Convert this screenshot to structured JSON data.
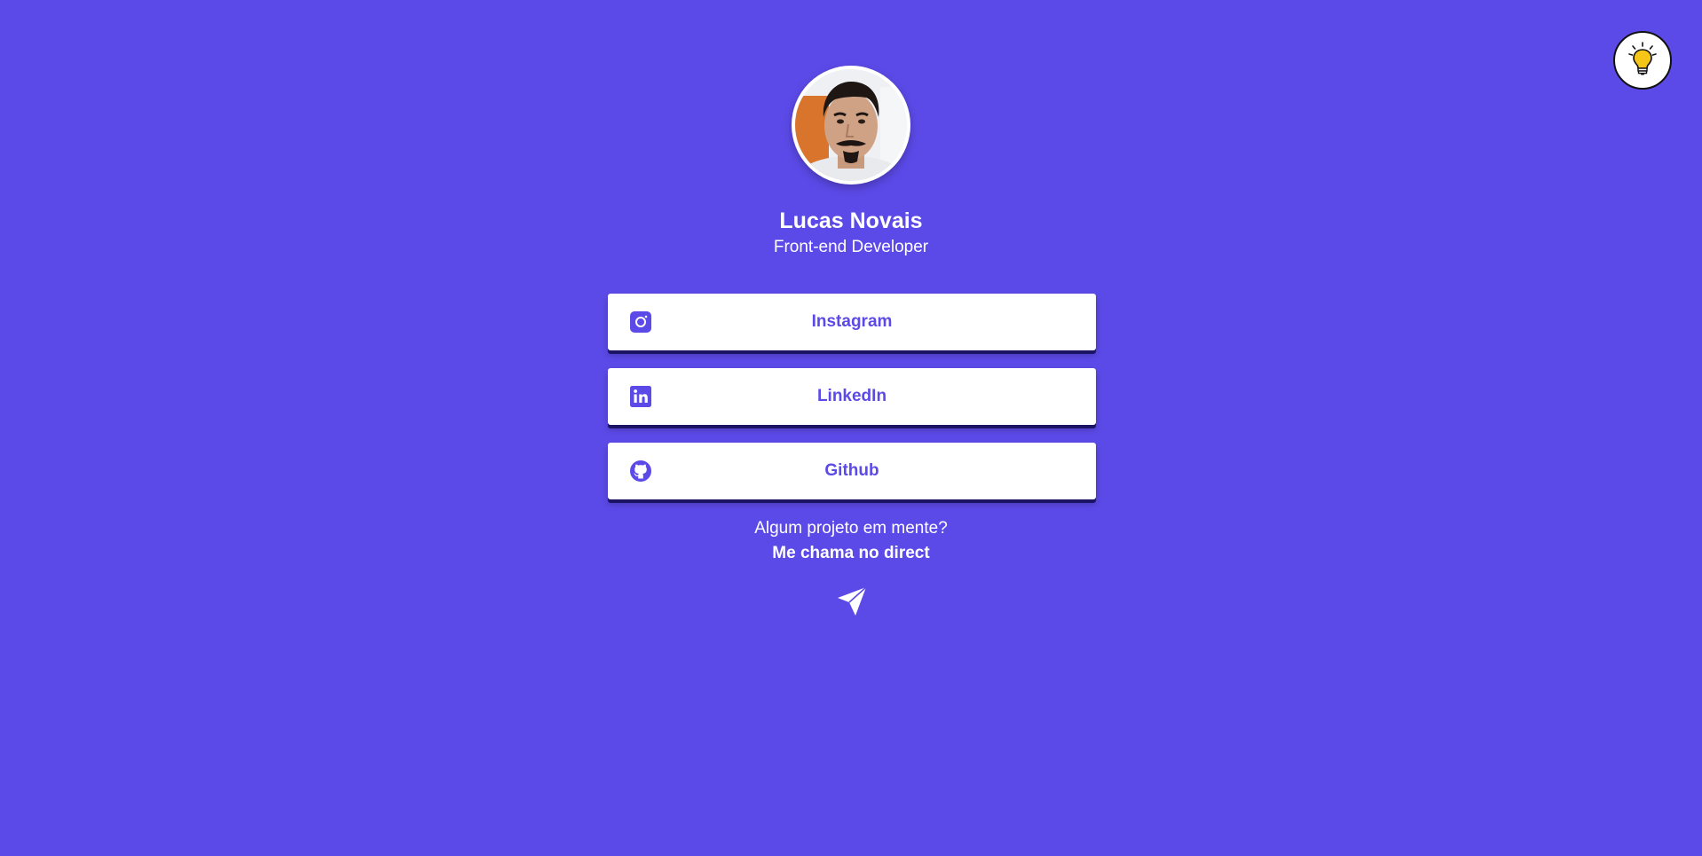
{
  "colors": {
    "background": "#5c4ae8",
    "card": "#ffffff",
    "accent": "#5c4ae8",
    "card_shadow": "#1b1464",
    "bulb": "#f5c518"
  },
  "theme_toggle": {
    "icon": "lightbulb-icon"
  },
  "profile": {
    "avatar": "avatar",
    "name": "Lucas Novais",
    "role": "Front-end Developer"
  },
  "links": [
    {
      "label": "Instagram",
      "icon": "instagram-icon"
    },
    {
      "label": "LinkedIn",
      "icon": "linkedin-icon"
    },
    {
      "label": "Github",
      "icon": "github-icon"
    }
  ],
  "cta": {
    "question": "Algum projeto em mente?",
    "action": "Me chama no direct",
    "icon": "send-icon"
  }
}
